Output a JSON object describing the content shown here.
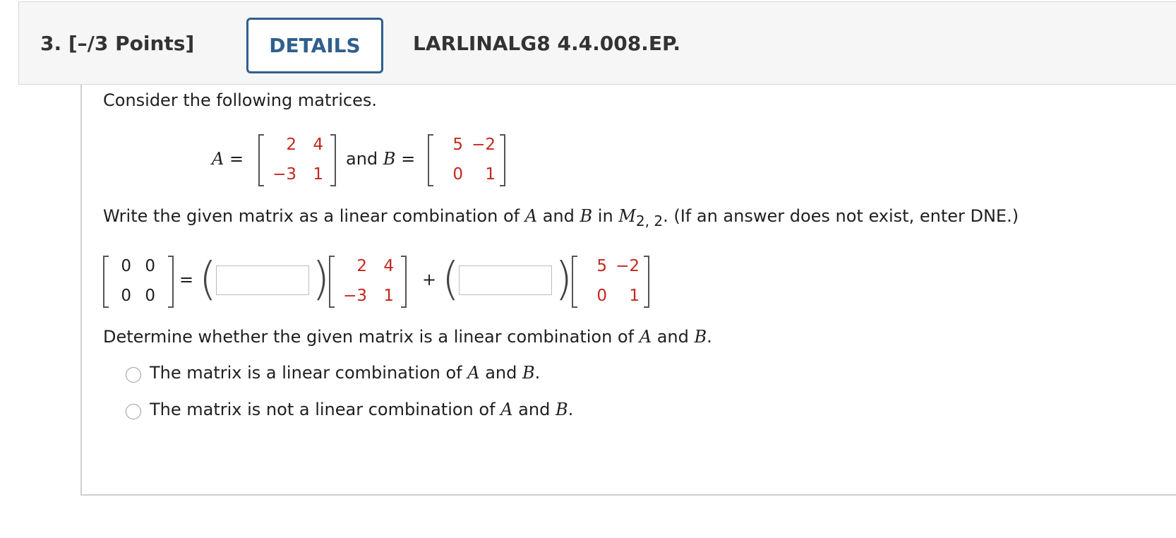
{
  "header": {
    "question_number": "3.",
    "points": "[–/3 Points]",
    "details_label": "DETAILS",
    "problem_id": "LARLINALG8 4.4.008.EP."
  },
  "prompt": {
    "intro": "Consider the following matrices.",
    "a_label": "A",
    "equals": "=",
    "and": "and",
    "b_label": "B",
    "instruction_prefix": "Write the given matrix as a linear combination of",
    "instruction_and": "and",
    "instruction_in": "in",
    "space_symbol": "M",
    "space_subscript": "2, 2",
    "instruction_suffix": ". (If an answer does not exist, enter DNE.)",
    "plus": "+"
  },
  "matrices": {
    "A": [
      [
        "2",
        "4"
      ],
      [
        "−3",
        "1"
      ]
    ],
    "B": [
      [
        "5",
        "−2"
      ],
      [
        "0",
        "1"
      ]
    ],
    "target": [
      [
        "0",
        "0"
      ],
      [
        "0",
        "0"
      ]
    ]
  },
  "answers": {
    "coef_a": "",
    "coef_b": ""
  },
  "determine": {
    "question_prefix": "Determine whether the given matrix is a linear combination of",
    "question_and": "and",
    "question_suffix": ".",
    "option1_prefix": "The matrix is a linear combination of",
    "option2_prefix": "The matrix is not a linear combination of",
    "option_and": "and",
    "option_suffix": "."
  },
  "colors": {
    "accent": "#2f5f8e",
    "matrix_entries": "#c4271f"
  }
}
